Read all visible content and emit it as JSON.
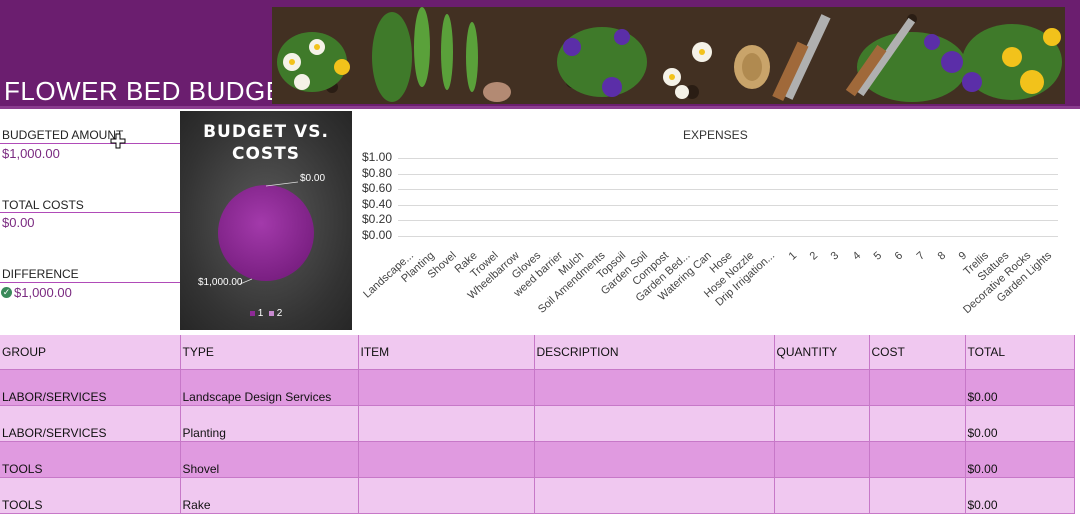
{
  "header": {
    "title": "FLOWER BED BUDGET"
  },
  "summary": {
    "budgeted_label": "BUDGETED AMOUNT",
    "budgeted_value": "$1,000.00",
    "costs_label": "TOTAL COSTS",
    "costs_value": "$0.00",
    "difference_label": "DIFFERENCE",
    "difference_value": "$1,000.00"
  },
  "pie_chart": {
    "title_line1": "BUDGET VS.",
    "title_line2": "COSTS",
    "label_costs": "$0.00",
    "label_budget": "$1,000.00",
    "legend": [
      "1",
      "2"
    ],
    "colors": [
      "#8e2a96",
      "#c88ad0"
    ]
  },
  "chart_data": [
    {
      "type": "pie",
      "title": "BUDGET VS. COSTS",
      "categories": [
        "1",
        "2"
      ],
      "values": [
        1000,
        0
      ]
    },
    {
      "type": "bar",
      "title": "EXPENSES",
      "yticks": [
        "$1.00",
        "$0.80",
        "$0.60",
        "$0.40",
        "$0.20",
        "$0.00"
      ],
      "ylim": [
        0,
        1
      ],
      "categories": [
        "Landscape...",
        "Planting",
        "Shovel",
        "Rake",
        "Trowel",
        "Wheelbarrow",
        "Gloves",
        "weed barrier",
        "Mulch",
        "Soil Amendments",
        "Topsoil",
        "Garden Soil",
        "Compost",
        "Garden Bed...",
        "Watering Can",
        "Hose",
        "Hose Nozzle",
        "Drip Irrigation...",
        "1",
        "2",
        "3",
        "4",
        "5",
        "6",
        "7",
        "8",
        "9",
        "Trellis",
        "Statues",
        "Decorative Rocks",
        "Garden Lights"
      ],
      "values": [
        0,
        0,
        0,
        0,
        0,
        0,
        0,
        0,
        0,
        0,
        0,
        0,
        0,
        0,
        0,
        0,
        0,
        0,
        0,
        0,
        0,
        0,
        0,
        0,
        0,
        0,
        0,
        0,
        0,
        0,
        0
      ]
    }
  ],
  "table": {
    "headers": [
      "GROUP",
      "TYPE",
      "ITEM",
      "DESCRIPTION",
      "QUANTITY",
      "COST",
      "TOTAL"
    ],
    "rows": [
      {
        "group": "LABOR/SERVICES",
        "type": "Landscape Design Services",
        "total": "$0.00"
      },
      {
        "group": "LABOR/SERVICES",
        "type": "Planting",
        "total": "$0.00"
      },
      {
        "group": "TOOLS",
        "type": "Shovel",
        "total": "$0.00"
      },
      {
        "group": "TOOLS",
        "type": "Rake",
        "total": "$0.00"
      }
    ]
  }
}
